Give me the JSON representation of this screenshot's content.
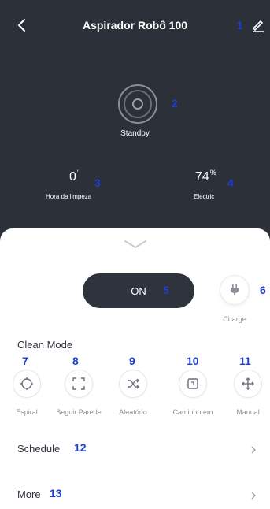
{
  "header": {
    "title": "Aspirador Robô 100",
    "back_icon": "chevron-left-icon",
    "edit_icon": "pencil-icon"
  },
  "status": {
    "text": "Standby",
    "icon": "robot-status-ring-icon"
  },
  "stats": {
    "clean_time": {
      "value": "0",
      "unit": "′",
      "label": "Hora da limpeza"
    },
    "battery": {
      "value": "74",
      "unit": "%",
      "label": "Electric"
    }
  },
  "controls": {
    "power_label": "ON",
    "charge_label": "Charge",
    "charge_icon": "plug-icon"
  },
  "clean_mode": {
    "title": "Clean Mode",
    "modes": [
      {
        "label": "Espiral",
        "icon": "spiral-target-icon"
      },
      {
        "label": "Seguir Parede",
        "icon": "wall-follow-icon"
      },
      {
        "label": "Aleatório",
        "icon": "shuffle-icon"
      },
      {
        "label": "Caminho em",
        "icon": "path-icon"
      },
      {
        "label": "Manual",
        "icon": "move-arrows-icon"
      }
    ]
  },
  "rows": {
    "schedule": "Schedule",
    "more": "More"
  },
  "callouts": [
    "1",
    "2",
    "3",
    "4",
    "5",
    "6",
    "7",
    "8",
    "9",
    "10",
    "11",
    "12",
    "13"
  ],
  "colors": {
    "background_dark": "#2c3038",
    "sheet": "#ffffff",
    "button_dark": "#2e333d",
    "callout": "#1c3fcf",
    "muted_text": "#8b8f97"
  }
}
